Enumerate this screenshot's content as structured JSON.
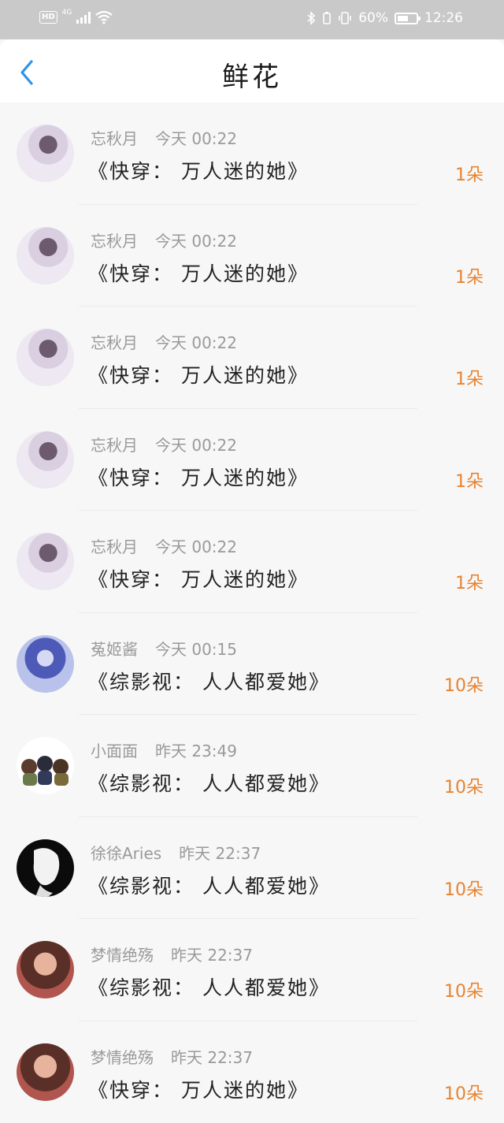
{
  "status_bar": {
    "hd": "HD",
    "network": "4G",
    "battery_percent": "60%",
    "battery_level": 0.6,
    "time": "12:26"
  },
  "header": {
    "title": "鲜花",
    "back_icon": "chevron-left-icon",
    "accent_color": "#2f93e6"
  },
  "colors": {
    "count": "#e7832f",
    "meta": "#9a9a9a",
    "book": "#222222"
  },
  "records": [
    {
      "user": "忘秋月",
      "time": "今天 00:22",
      "book": "《快穿： 万人迷的她》",
      "count": "1朵"
    },
    {
      "user": "忘秋月",
      "time": "今天 00:22",
      "book": "《快穿： 万人迷的她》",
      "count": "1朵"
    },
    {
      "user": "忘秋月",
      "time": "今天 00:22",
      "book": "《快穿： 万人迷的她》",
      "count": "1朵"
    },
    {
      "user": "忘秋月",
      "time": "今天 00:22",
      "book": "《快穿： 万人迷的她》",
      "count": "1朵"
    },
    {
      "user": "忘秋月",
      "time": "今天 00:22",
      "book": "《快穿： 万人迷的她》",
      "count": "1朵"
    },
    {
      "user": "菟姬酱",
      "time": "今天 00:15",
      "book": "《综影视： 人人都爱她》",
      "count": "10朵"
    },
    {
      "user": "小面面",
      "time": "昨天 23:49",
      "book": "《综影视： 人人都爱她》",
      "count": "10朵"
    },
    {
      "user": "徐徐Aries",
      "time": "昨天 22:37",
      "book": "《综影视： 人人都爱她》",
      "count": "10朵"
    },
    {
      "user": "梦情绝殇",
      "time": "昨天 22:37",
      "book": "《综影视： 人人都爱她》",
      "count": "10朵"
    },
    {
      "user": "梦情绝殇",
      "time": "昨天 22:37",
      "book": "《快穿： 万人迷的她》",
      "count": "10朵"
    }
  ]
}
